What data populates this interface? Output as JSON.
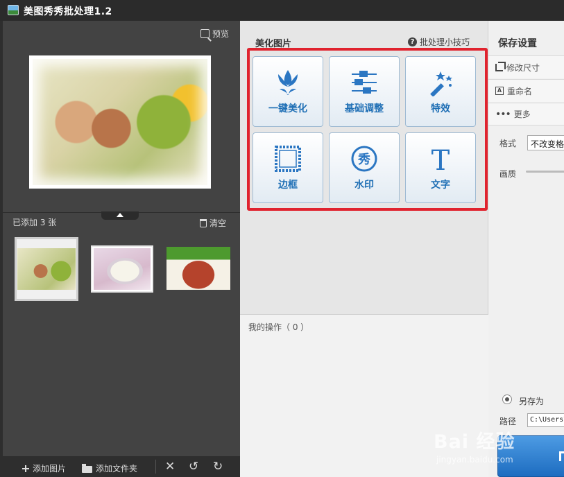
{
  "window": {
    "title": "美图秀秀批处理1.2"
  },
  "left": {
    "preview_label": "预览",
    "added_count": "已添加 3 张",
    "clear_label": "清空",
    "bottom": {
      "add_image": "添加图片",
      "add_folder": "添加文件夹"
    }
  },
  "center": {
    "section_title": "美化图片",
    "tips_link": "批处理小技巧",
    "tools": [
      {
        "label": "一键美化",
        "icon": "tulip-icon"
      },
      {
        "label": "基础调整",
        "icon": "sliders-icon"
      },
      {
        "label": "特效",
        "icon": "magic-wand-icon"
      },
      {
        "label": "边框",
        "icon": "frame-icon"
      },
      {
        "label": "水印",
        "icon": "watermark-icon",
        "glyph": "秀"
      },
      {
        "label": "文字",
        "icon": "text-icon",
        "glyph": "T"
      }
    ],
    "my_operations": "我的操作（ 0 ）"
  },
  "right": {
    "title": "保存设置",
    "resize": "修改尺寸",
    "rename": "重命名",
    "more": "更多",
    "format_label": "格式",
    "format_value": "不改变格式",
    "quality_label": "画质",
    "save_as": "另存为",
    "path_label": "路径",
    "path_value": "C:\\Users\\"
  },
  "watermark": {
    "brand": "Bai 经验",
    "url": "jingyan.baidu.com"
  },
  "colors": {
    "accent_blue": "#1f6fb5",
    "highlight_red": "#e0232e",
    "dark_panel": "#434343"
  }
}
